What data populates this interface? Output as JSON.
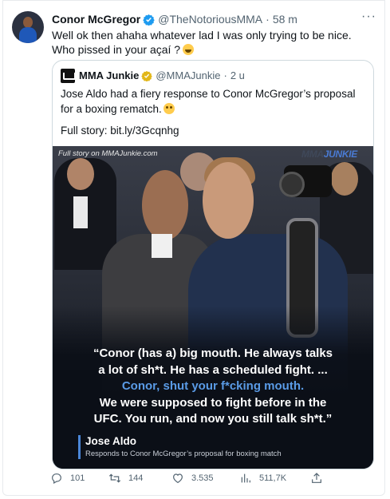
{
  "tweet": {
    "author_name": "Conor McGregor",
    "handle": "@TheNotoriousMMA",
    "separator": "·",
    "time": "58 m",
    "more_icon": "more-icon",
    "text": "Well ok then ahaha whatever lad I was only trying to be nice. Who pissed in your açaí ?",
    "emoji": "tears-of-joy-emoji"
  },
  "quoted_tweet": {
    "author_name": "MMA Junkie",
    "handle": "@MMAJunkie",
    "separator": "·",
    "time": "2 u",
    "text": "Jose Aldo had a fiery response to Conor McGregor’s proposal for a boxing rematch.",
    "emoji": "flushed-face-emoji",
    "link_text": "Full story: bit.ly/3Gcqnhg",
    "image": {
      "credit": "Full story on MMAJunkie.com",
      "brand_part1": "MMA",
      "brand_part2": "JUNKIE",
      "quote_lines": [
        "“Conor (has a) big mouth. He always talks",
        "a lot of sh*t. He has a scheduled fight. ...",
        "Conor, shut your f*cking mouth.",
        "We were supposed to fight before in the",
        "UFC. You run, and now you still talk sh*t.”"
      ],
      "attribution_name": "Jose Aldo",
      "attribution_sub": "Responds to Conor McGregor’s proposal for boxing match"
    }
  },
  "actions": {
    "replies": "101",
    "retweets": "144",
    "likes": "3.535",
    "views": "511,7K"
  },
  "colors": {
    "verified": "#1d9bf0",
    "gold_verified": "#e2b719",
    "highlight": "#5a9be6",
    "muted": "#536471"
  }
}
